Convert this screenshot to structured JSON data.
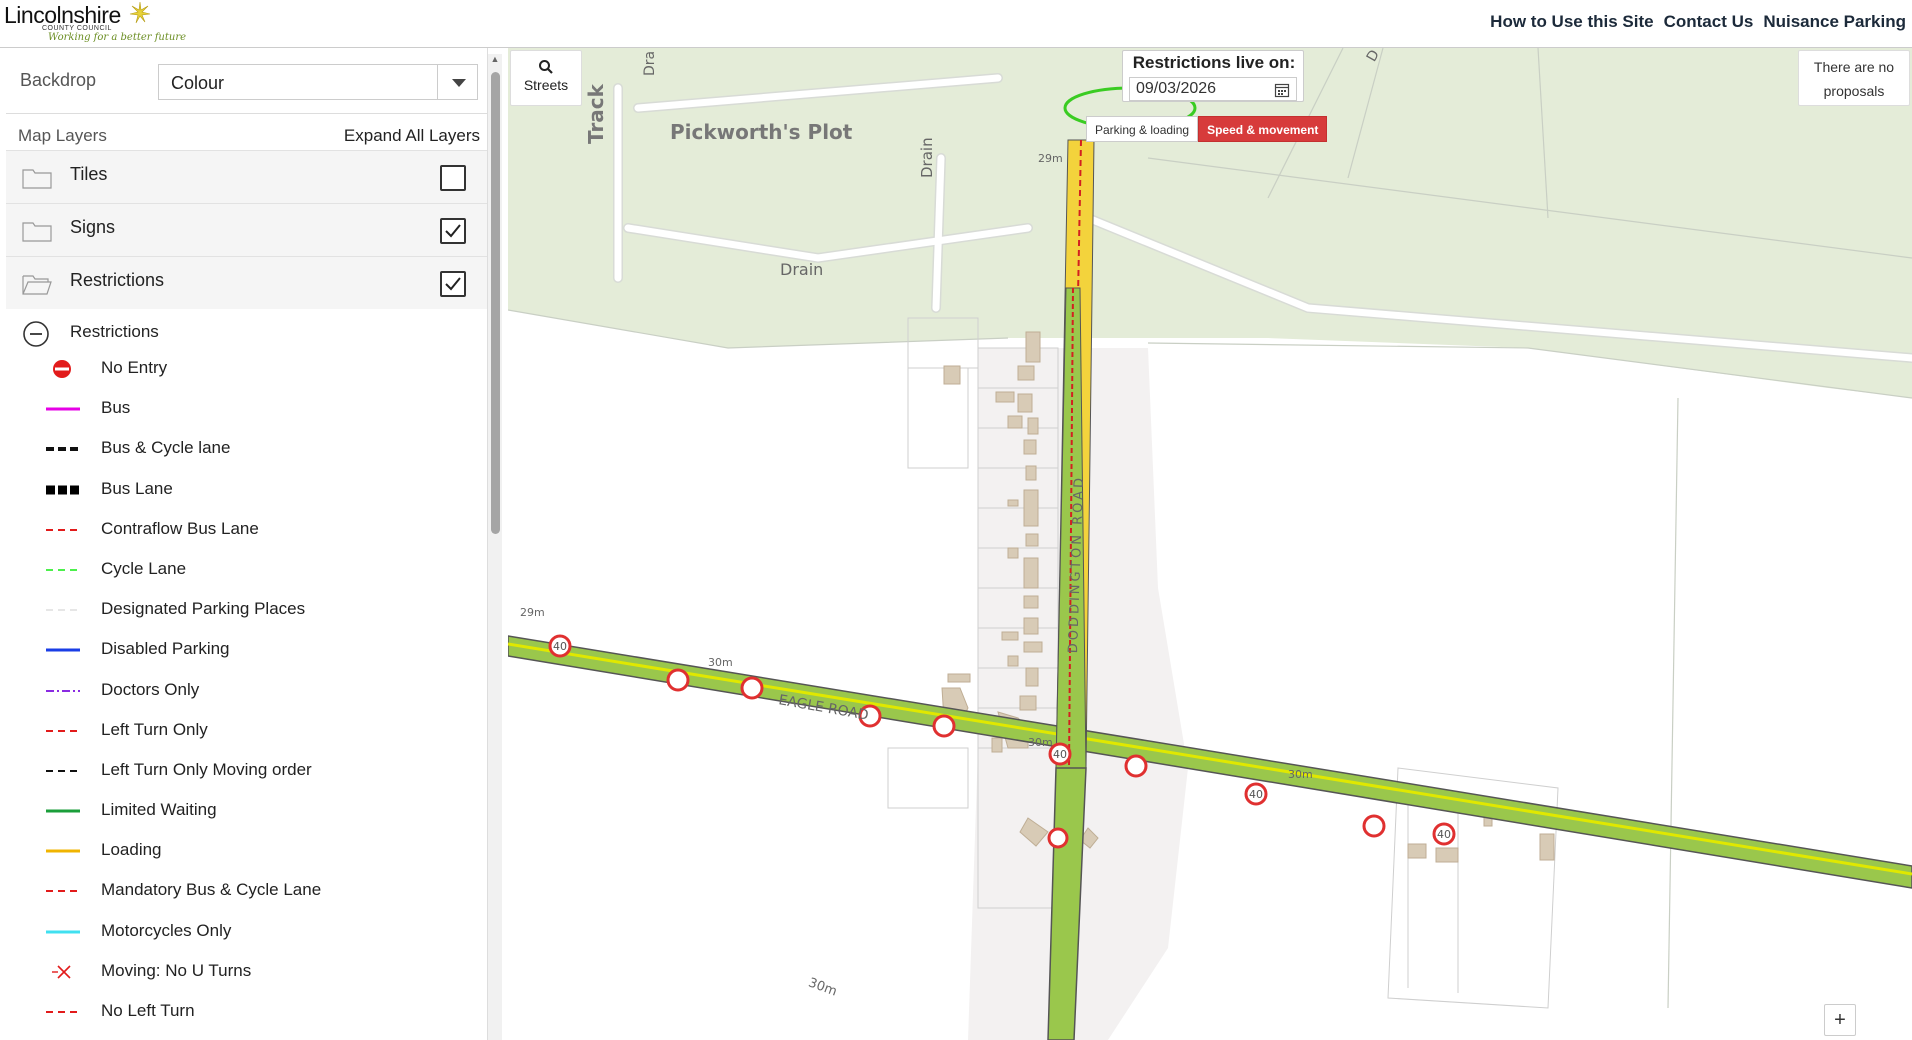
{
  "header": {
    "logo_title": "Lincolnshire",
    "logo_subtitle": "COUNTY COUNCIL",
    "logo_tagline": "Working for a better future",
    "nav": [
      "How to Use this Site",
      "Contact Us",
      "Nuisance Parking"
    ]
  },
  "sidebar": {
    "backdrop_label": "Backdrop",
    "backdrop_value": "Colour",
    "map_layers_title": "Map Layers",
    "expand_all_label": "Expand All Layers",
    "groups": [
      {
        "label": "Tiles",
        "checked": false,
        "icon": "folder-icon"
      },
      {
        "label": "Signs",
        "checked": true,
        "icon": "folder-icon"
      },
      {
        "label": "Restrictions",
        "checked": true,
        "icon": "folder-open-icon"
      }
    ],
    "sub_group_label": "Restrictions",
    "legend": [
      {
        "label": "No Entry",
        "symbol": "no-entry",
        "color": "#e21b1b"
      },
      {
        "label": "Bus",
        "symbol": "solid",
        "color": "#e600e6"
      },
      {
        "label": "Bus & Cycle lane",
        "symbol": "dash-thick",
        "color": "#111111"
      },
      {
        "label": "Bus Lane",
        "symbol": "block",
        "color": "#000000"
      },
      {
        "label": "Contraflow Bus Lane",
        "symbol": "dash",
        "color": "#e21b1b"
      },
      {
        "label": "Cycle Lane",
        "symbol": "dash",
        "color": "#4cf04c"
      },
      {
        "label": "Designated Parking Places",
        "symbol": "dash",
        "color": "#e6e6e6"
      },
      {
        "label": "Disabled Parking",
        "symbol": "solid",
        "color": "#1a3ee6"
      },
      {
        "label": "Doctors Only",
        "symbol": "dashdot",
        "color": "#8a2be2"
      },
      {
        "label": "Left Turn Only",
        "symbol": "dash",
        "color": "#e21b1b"
      },
      {
        "label": "Left Turn Only Moving order",
        "symbol": "dash",
        "color": "#111111"
      },
      {
        "label": "Limited Waiting",
        "symbol": "solid",
        "color": "#1a9e3a"
      },
      {
        "label": "Loading",
        "symbol": "solid",
        "color": "#f0b400"
      },
      {
        "label": "Mandatory Bus & Cycle Lane",
        "symbol": "dash",
        "color": "#e21b1b"
      },
      {
        "label": "Motorcycles Only",
        "symbol": "solid",
        "color": "#40e0f0"
      },
      {
        "label": "Moving: No U Turns",
        "symbol": "cross",
        "color": "#e21b1b"
      },
      {
        "label": "No Left Turn",
        "symbol": "dash",
        "color": "#e21b1b"
      }
    ]
  },
  "map": {
    "streets_label": "Streets",
    "restrictions_live_title": "Restrictions live on:",
    "date_value": "09/03/2026",
    "mode_buttons": [
      {
        "label": "Parking & loading",
        "active": false
      },
      {
        "label": "Speed & movement",
        "active": true
      }
    ],
    "proposals_line1": "There are no",
    "proposals_line2": "proposals",
    "zoom_in": "+",
    "labels": {
      "place": "Pickworth's Plot",
      "track": "Track",
      "drain_top": "Dra",
      "drain_vertical": "Drain",
      "drain_bottom": "Drain",
      "drain_right": "D",
      "road_north": "DODDINGTON ROAD",
      "road_main": "EAGLE ROAD",
      "elev_29_top": "29m",
      "elev_29_left": "29m",
      "elev_30_left": "30m",
      "elev_30_center": "30m",
      "elev_30_right": "30m",
      "elev_30_bottom": "30m",
      "speed": "40"
    }
  }
}
